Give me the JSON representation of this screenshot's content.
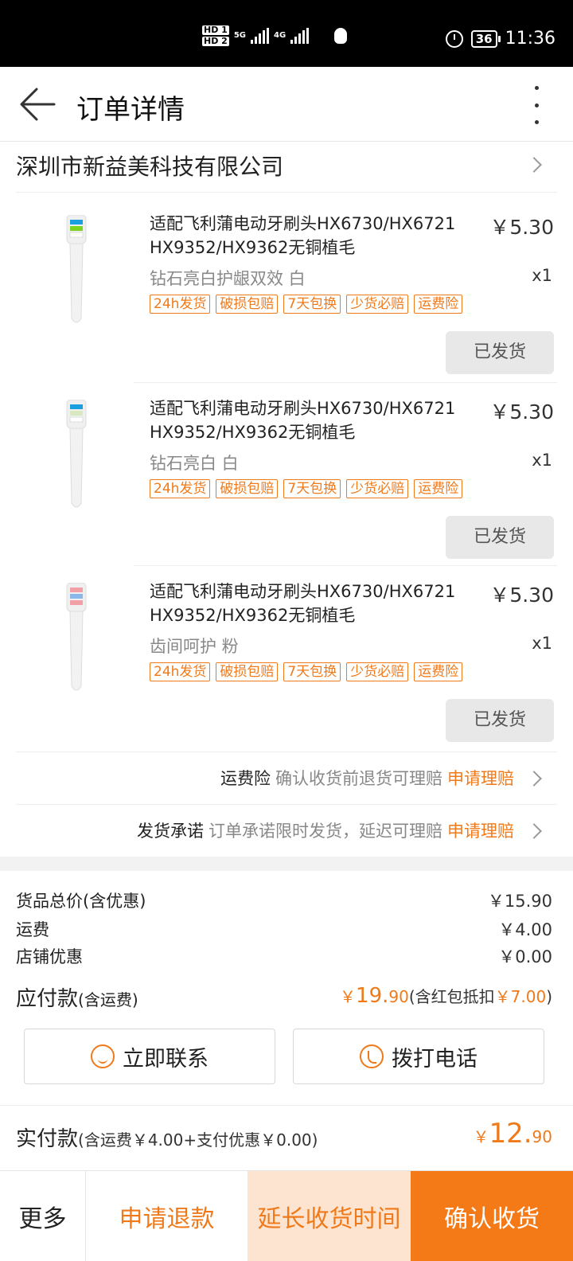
{
  "status_bar": {
    "hd1": "HD 1",
    "hd2": "HD 2",
    "net1": "5G",
    "net2": "4G",
    "battery": "36",
    "time": "11:36"
  },
  "header": {
    "title": "订单详情"
  },
  "shop": {
    "name": "深圳市新益美科技有限公司"
  },
  "items": [
    {
      "title": "适配飞利蒲电动牙刷头HX6730/HX6721 HX9352/HX9362无铜植毛",
      "price": "￥5.30",
      "spec": "钻石亮白护龈双效 白",
      "qty": "x1",
      "tags": [
        "24h发货",
        "破损包赔",
        "7天包换",
        "少货必赔",
        "运费险"
      ],
      "status": "已发货",
      "bristle_color": "#1aa0e0",
      "bristle_accent": "#7ed321"
    },
    {
      "title": "适配飞利蒲电动牙刷头HX6730/HX6721 HX9352/HX9362无铜植毛",
      "price": "￥5.30",
      "spec": "钻石亮白 白",
      "qty": "x1",
      "tags": [
        "24h发货",
        "破损包赔",
        "7天包换",
        "少货必赔",
        "运费险"
      ],
      "status": "已发货",
      "bristle_color": "#1aa0e0",
      "bristle_accent": "#d8e8c0"
    },
    {
      "title": "适配飞利蒲电动牙刷头HX6730/HX6721 HX9352/HX9362无铜植毛",
      "price": "￥5.30",
      "spec": "齿间呵护 粉",
      "qty": "x1",
      "tags": [
        "24h发货",
        "破损包赔",
        "7天包换",
        "少货必赔",
        "运费险"
      ],
      "status": "已发货",
      "bristle_color": "#f2a0a8",
      "bristle_accent": "#8ab8e8"
    }
  ],
  "insurance": {
    "label": "运费险",
    "desc": "确认收货前退货可理赔",
    "link": "申请理赔"
  },
  "promise": {
    "label": "发货承诺",
    "desc": "订单承诺限时发货，延迟可理赔",
    "link": "申请理赔"
  },
  "summary": {
    "goods_label": "货品总价(含优惠)",
    "goods_value": "￥15.90",
    "shipping_label": "运费",
    "shipping_value": "￥4.00",
    "discount_label": "店铺优惠",
    "discount_value": "￥0.00",
    "payable_label": "应付款",
    "payable_note": "(含运费)",
    "payable_currency": "￥",
    "payable_int": "19.",
    "payable_dec": "90",
    "payable_extra": "(含红包抵扣",
    "payable_redpack": "￥7.00",
    "payable_close": ")"
  },
  "contact": {
    "chat_label": "立即联系",
    "call_label": "拨打电话"
  },
  "actual": {
    "label": "实付款",
    "note": "(含运费￥4.00+支付优惠￥0.00)",
    "currency": "￥",
    "int": "12.",
    "dec": "90"
  },
  "bottom": {
    "more": "更多",
    "refund": "申请退款",
    "extend": "延长收货时间",
    "confirm": "确认收货"
  },
  "colors": {
    "accent": "#f07a1a",
    "confirm_bg": "#f47a17",
    "extend_bg": "#fde4d0"
  }
}
